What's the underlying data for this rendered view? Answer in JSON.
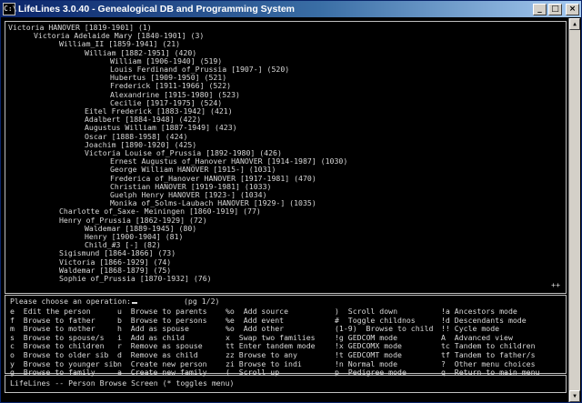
{
  "window": {
    "title": "LifeLines 3.0.40 - Genealogical DB and Programming System",
    "icon": "terminal-icon",
    "minimize": "_",
    "maximize": "□",
    "close": "×"
  },
  "tree": [
    "Victoria HANOVER [1819-1901] (1)",
    "Victoria Adelaide Mary [1840-1901] (3)",
    "William_II [1859-1941] (21)",
    "William [1882-1951] (420)",
    "William [1906-1940] (519)",
    "Louis Ferdinand of_Prussia [1907-] (520)",
    "Hubertus [1909-1950] (521)",
    "Frederick [1911-1966] (522)",
    "Alexandrine [1915-1980] (523)",
    "Cecilie [1917-1975] (524)",
    "Eitel Frederick [1883-1942] (421)",
    "Adalbert [1884-1948] (422)",
    "Augustus William [1887-1949] (423)",
    "Oscar [1888-1958] (424)",
    "Joachim [1890-1920] (425)",
    "Victoria Louise of_Prussia [1892-1980] (426)",
    "Ernest Augustus of_Hanover HANOVER [1914-1987] (1030)",
    "George William HANOVER [1915-] (1031)",
    "Frederica of_Hanover HANOVER [1917-1981] (470)",
    "Christian HANOVER [1919-1981] (1033)",
    "Guelph Henry HANOVER [1923-] (1034)",
    "Monika of_Solms-Laubach HANOVER [1929-] (1035)",
    "Charlotte of_Saxe- Meiningen [1860-1919] (77)",
    "Henry of_Prussia [1862-1929] (72)",
    "Waldemar [1889-1945] (80)",
    "Henry [1900-1904] (81)",
    "Child_#3 [-] (82)",
    "Sigismund [1864-1866] (73)",
    "Victoria [1866-1929] (74)",
    "Waldemar [1868-1879] (75)",
    "Sophie of_Prussia [1870-1932] (76)"
  ],
  "more_indicator": "++",
  "prompt": "Please choose an operation:",
  "page_indicator": "(pg 1/2)",
  "menu": [
    [
      "e  Edit the person",
      "u  Browse to parents",
      "%o  Add source",
      ")  Scroll down",
      "!a Ancestors mode"
    ],
    [
      "f  Browse to father",
      "b  Browse to persons",
      "%e  Add event",
      "#  Toggle childnos",
      "!d Descendants mode"
    ],
    [
      "m  Browse to mother",
      "h  Add as spouse",
      "%o  Add other",
      "(1-9)  Browse to child",
      "!! Cycle mode"
    ],
    [
      "s  Browse to spouse/s",
      "i  Add as child",
      "x  Swap two families",
      "!g GEDCOM mode",
      "A  Advanced view"
    ],
    [
      "c  Browse to children",
      "r  Remove as spouse",
      "tt Enter tandem mode",
      "!x GEDCOMX mode",
      "tc Tandem to children"
    ],
    [
      "o  Browse to older sib",
      "d  Remove as child",
      "zz Browse to any",
      "!t GEDCOMT mode",
      "tf Tandem to father/s"
    ],
    [
      "y  Browse to younger sib",
      "n  Create new person",
      "zi Browse to indi",
      "!n Normal mode",
      "?  Other menu choices"
    ],
    [
      "g  Browse to family",
      "a  Create new family",
      "(  Scroll up",
      "p  Pedigree mode",
      "q  Return to main menu"
    ]
  ],
  "status": "LifeLines -- Person Browse Screen (* toggles menu)",
  "colors": {
    "background": "#000000",
    "text": "#d8d8d8",
    "titlebar": "#0a246a"
  }
}
